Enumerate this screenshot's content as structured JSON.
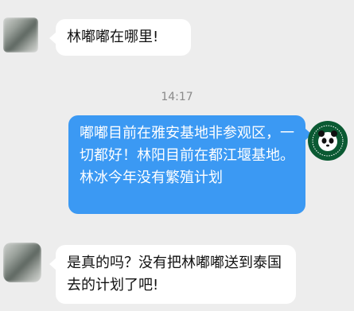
{
  "chat": {
    "timestamp": "14:17",
    "messages": [
      {
        "side": "left",
        "text": "林嘟嘟在哪里!"
      },
      {
        "side": "right",
        "text": "嘟嘟目前在雅安基地非参观区，一切都好！林阳目前在都江堰基地。林冰今年没有繁殖计划"
      },
      {
        "side": "left",
        "text": "是真的吗？没有把林嘟嘟送到泰国去的计划了吧!"
      }
    ]
  },
  "icons": {
    "left_avatar": "user-avatar-icon",
    "right_avatar": "panda-organization-logo-icon"
  }
}
